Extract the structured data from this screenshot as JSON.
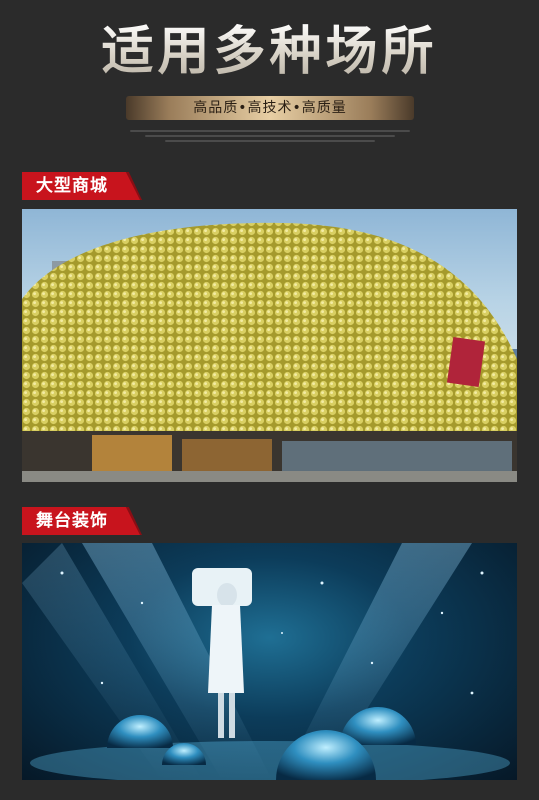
{
  "header": {
    "title": "适用多种场所",
    "subtitle": "高品质•高技术•高质量"
  },
  "sections": [
    {
      "label": "大型商城",
      "image": "shopping-mall-gold-facade-photo"
    },
    {
      "label": "舞台装饰",
      "image": "stage-performance-photo"
    }
  ],
  "colors": {
    "background": "#2b2b2b",
    "tag_red": "#c8141d",
    "gold_bar": "#e8cfa4"
  }
}
